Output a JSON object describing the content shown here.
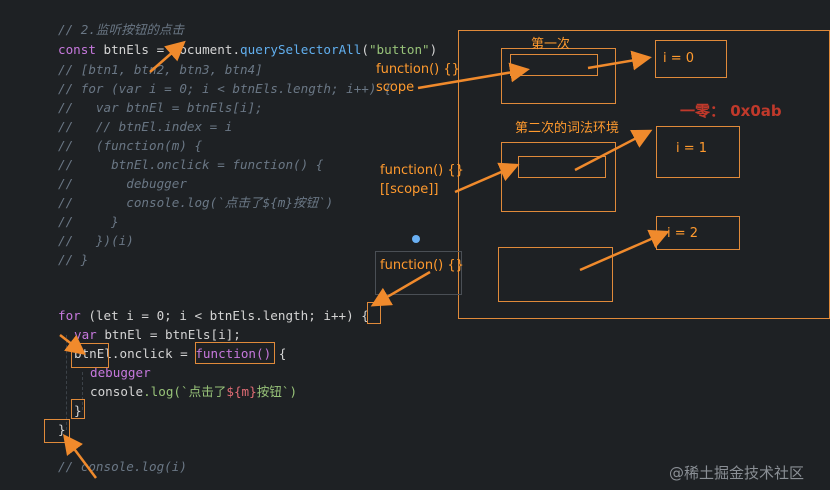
{
  "code": {
    "comment_lines": [
      "// 2.监听按钮的点击",
      "// [btn1, btn2, btn3, btn4]",
      "// for (var i = 0; i < btnEls.length; i++) {",
      "//   var btnEl = btnEls[i];",
      "//   // btnEl.index = i",
      "//   (function(m) {",
      "//     btnEl.onclick = function() {",
      "//       debugger",
      "//       console.log(`点击了${m}按钮`)",
      "//     }",
      "//   })(i)",
      "// }"
    ],
    "line1": {
      "kw": "const",
      "name": " btnEls ",
      "eq": "= ",
      "obj": "document",
      "dot": ".",
      "method": "querySelectorAll",
      "open": "(",
      "arg": "\"button\"",
      "close": ")"
    },
    "loop": {
      "for_kw": "for",
      "head": " (let i = 0; i < btnEls.length; i++) ",
      "brace_open": "{",
      "var_line_kw": "var",
      "var_line_rest": " btnEl = btnEls[i];",
      "onclick_obj": "btnEl",
      "onclick_prop": ".onclick = ",
      "function_text": "function()",
      "onclick_brace": " {",
      "debugger": "debugger",
      "console_obj": "console",
      "console_rest": ".log(`点击了",
      "template_var": "${m}",
      "template_end": "按钮`)",
      "inner_close": "}",
      "outer_close": "}",
      "trailing_comment": "// console.log(i)"
    }
  },
  "annotations": {
    "first": "第一次",
    "second_env": "第二次的词法环境",
    "fn1": "function() {}",
    "scope1": "scope",
    "fn2": "function() {}",
    "scope2": "[[scope]]",
    "fn3": "function() {}",
    "i0": "i = 0",
    "i1": "i = 1",
    "i2": "i = 2",
    "offscreen_red": "一零： 0x0ab"
  },
  "watermark": "@稀土掘金技术社区",
  "colors": {
    "accent": "#ff9a2e",
    "background": "#1e2124"
  }
}
